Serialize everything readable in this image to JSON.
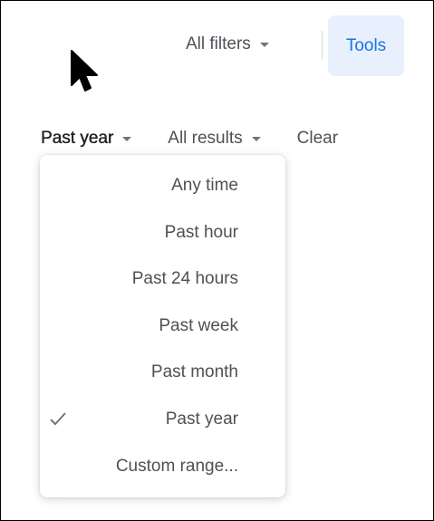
{
  "top_bar": {
    "all_filters_label": "All filters",
    "tools_label": "Tools"
  },
  "tools_row": {
    "time_filter_label": "Past year",
    "results_filter_label": "All results",
    "clear_label": "Clear"
  },
  "time_menu": {
    "items": [
      {
        "label": "Any time",
        "selected": false
      },
      {
        "label": "Past hour",
        "selected": false
      },
      {
        "label": "Past 24 hours",
        "selected": false
      },
      {
        "label": "Past week",
        "selected": false
      },
      {
        "label": "Past month",
        "selected": false
      },
      {
        "label": "Past year",
        "selected": true
      },
      {
        "label": "Custom range...",
        "selected": false
      }
    ]
  },
  "colors": {
    "accent": "#1a73e8",
    "tools_bg": "#e8f0fe",
    "text": "#4d5156",
    "text_dark": "#202124"
  }
}
